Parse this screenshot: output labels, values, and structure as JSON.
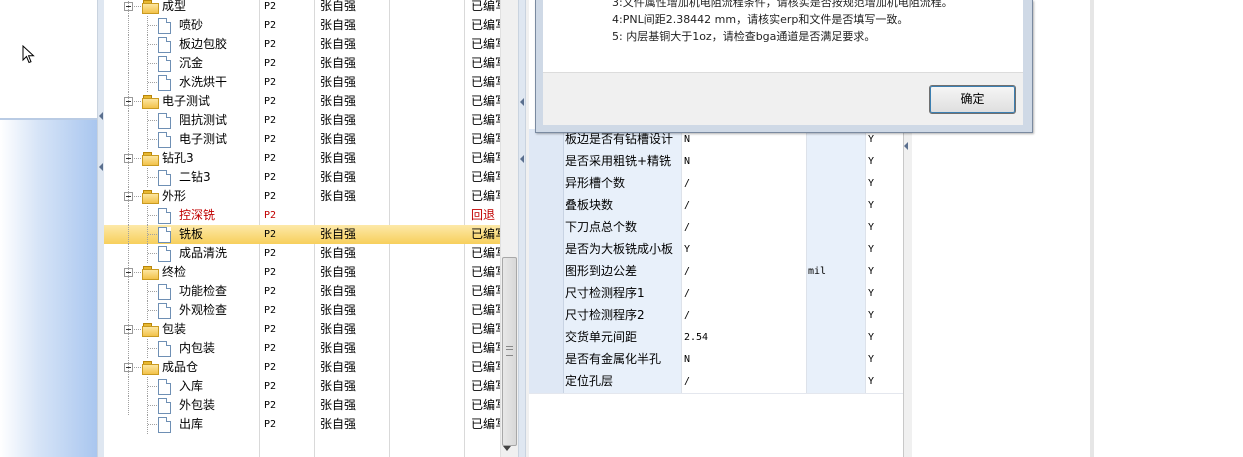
{
  "tree": {
    "rows": [
      {
        "kind": "folder",
        "level": 0,
        "name": "成型",
        "lv": "P2",
        "user": "张自强",
        "status": "已编写",
        "expanded": true
      },
      {
        "kind": "item",
        "name": "喷砂",
        "lv": "P2",
        "user": "张自强",
        "status": "已编写"
      },
      {
        "kind": "item",
        "name": "板边包胶",
        "lv": "P2",
        "user": "张自强",
        "status": "已编写"
      },
      {
        "kind": "item",
        "name": "沉金",
        "lv": "P2",
        "user": "张自强",
        "status": "已编写"
      },
      {
        "kind": "item",
        "name": "水洗烘干",
        "lv": "P2",
        "user": "张自强",
        "status": "已编写"
      },
      {
        "kind": "folder",
        "name": "电子测试",
        "lv": "P2",
        "user": "张自强",
        "status": "已编写"
      },
      {
        "kind": "item",
        "name": "阻抗测试",
        "lv": "P2",
        "user": "张自强",
        "status": "已编写"
      },
      {
        "kind": "item",
        "name": "电子测试",
        "lv": "P2",
        "user": "张自强",
        "status": "已编写"
      },
      {
        "kind": "folder",
        "name": "钻孔3",
        "lv": "P2",
        "user": "张自强",
        "status": "已编写"
      },
      {
        "kind": "item",
        "name": "二钻3",
        "lv": "P2",
        "user": "张自强",
        "status": "已编写"
      },
      {
        "kind": "folder",
        "name": "外形",
        "lv": "P2",
        "user": "张自强",
        "status": "已编写"
      },
      {
        "kind": "item",
        "name": "控深铣",
        "lv": "P2",
        "user": "",
        "status": "回退",
        "red": true
      },
      {
        "kind": "item",
        "name": "铣板",
        "lv": "P2",
        "user": "张自强",
        "status": "已编写",
        "selected": true
      },
      {
        "kind": "item",
        "name": "成品清洗",
        "lv": "P2",
        "user": "张自强",
        "status": "已编写"
      },
      {
        "kind": "folder",
        "name": "终检",
        "lv": "P2",
        "user": "张自强",
        "status": "已编写"
      },
      {
        "kind": "item",
        "name": "功能检查",
        "lv": "P2",
        "user": "张自强",
        "status": "已编写"
      },
      {
        "kind": "item",
        "name": "外观检查",
        "lv": "P2",
        "user": "张自强",
        "status": "已编写"
      },
      {
        "kind": "folder",
        "name": "包装",
        "lv": "P2",
        "user": "张自强",
        "status": "已编写"
      },
      {
        "kind": "item",
        "name": "内包装",
        "lv": "P2",
        "user": "张自强",
        "status": "已编写"
      },
      {
        "kind": "folder",
        "name": "成品仓",
        "lv": "P2",
        "user": "张自强",
        "status": "已编写"
      },
      {
        "kind": "item",
        "name": "入库",
        "lv": "P2",
        "user": "张自强",
        "status": "已编写"
      },
      {
        "kind": "item",
        "name": "外包装",
        "lv": "P2",
        "user": "张自强",
        "status": "已编写"
      },
      {
        "kind": "item",
        "name": "出库",
        "lv": "P2",
        "user": "张自强",
        "status": "已编写"
      }
    ]
  },
  "params": {
    "rows": [
      {
        "label": "板边是否有钻槽设计",
        "value": "N",
        "unit": "",
        "flag": "Y"
      },
      {
        "label": "是否采用粗铣+精铣",
        "value": "N",
        "unit": "",
        "flag": "Y"
      },
      {
        "label": "异形槽个数",
        "value": "/",
        "unit": "",
        "flag": "Y"
      },
      {
        "label": "叠板块数",
        "value": "/",
        "unit": "",
        "flag": "Y"
      },
      {
        "label": "下刀点总个数",
        "value": "/",
        "unit": "",
        "flag": "Y"
      },
      {
        "label": "是否为大板铣成小板",
        "value": "Y",
        "unit": "",
        "flag": "Y"
      },
      {
        "label": "图形到边公差",
        "value": "/",
        "unit": "mil",
        "flag": "Y"
      },
      {
        "label": "尺寸检测程序1",
        "value": "/",
        "unit": "",
        "flag": "Y"
      },
      {
        "label": "尺寸检测程序2",
        "value": "/",
        "unit": "",
        "flag": "Y"
      },
      {
        "label": "交货单元间距",
        "value": "2.54",
        "unit": "",
        "flag": "Y"
      },
      {
        "label": "是否有金属化半孔",
        "value": "N",
        "unit": "",
        "flag": "Y"
      },
      {
        "label": "定位孔层",
        "value": "/",
        "unit": "",
        "flag": "Y"
      }
    ]
  },
  "dialog": {
    "messages": [
      "3:文件属性增加机电阻流程条件，请核实是否按规范增加机电阻流程。",
      "4:PNL间距2.38442 mm，请核实erp和文件是否填写一致。",
      "5: 内层基铜大于1oz，请检查bga通道是否满足要求。"
    ],
    "ok_label": "确定"
  }
}
